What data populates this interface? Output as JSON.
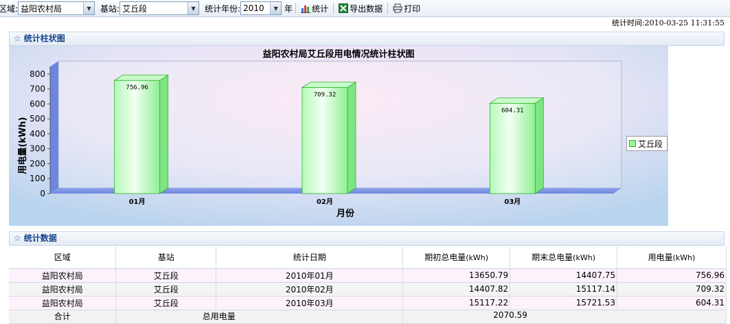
{
  "toolbar": {
    "area_label": "区域:",
    "area_value": "益阳农村局",
    "station_label": "基站:",
    "station_value": "艾丘段",
    "year_label": "统计年份:",
    "year_value": "2010",
    "year_suffix": "年",
    "stat_button": "统计",
    "export_button": "导出数据",
    "print_button": "打印"
  },
  "stat_time": "统计时间:2010-03-25 11:31:55",
  "chart_panel_title": "统计柱状图",
  "data_panel_title": "统计数据",
  "chart_data": {
    "type": "bar",
    "title": "益阳农村局艾丘段用电情况统计柱状图",
    "xlabel": "月份",
    "ylabel": "用电量(kWh)",
    "categories": [
      "01月",
      "02月",
      "03月"
    ],
    "series": [
      {
        "name": "艾丘段",
        "values": [
          756.96,
          709.32,
          604.31
        ]
      }
    ],
    "value_labels": [
      "756.96",
      "709.32",
      "604.31"
    ],
    "yticks": [
      "0",
      "100",
      "200",
      "300",
      "400",
      "500",
      "600",
      "700",
      "800"
    ],
    "ylim": [
      0,
      850
    ],
    "grid": false,
    "legend": "right",
    "colors": {
      "bar": "#98f59a",
      "bar_edge": "#2bb32b",
      "wall": "#6f86e0"
    }
  },
  "table": {
    "headers": [
      "区域",
      "基站",
      "统计日期",
      "期初总电量",
      "期末总电量",
      "用电量"
    ],
    "header_units": [
      "",
      "",
      "",
      "(kWh)",
      "(kWh)",
      "(kWh)"
    ],
    "rows": [
      [
        "益阳农村局",
        "艾丘段",
        "2010年01月",
        "13650.79",
        "14407.75",
        "756.96"
      ],
      [
        "益阳农村局",
        "艾丘段",
        "2010年02月",
        "14407.82",
        "15117.14",
        "709.32"
      ],
      [
        "益阳农村局",
        "艾丘段",
        "2010年03月",
        "15117.22",
        "15721.53",
        "604.31"
      ]
    ],
    "total_label": "合计",
    "total_power_label": "总用电量",
    "total_power_value": "2070.59"
  }
}
